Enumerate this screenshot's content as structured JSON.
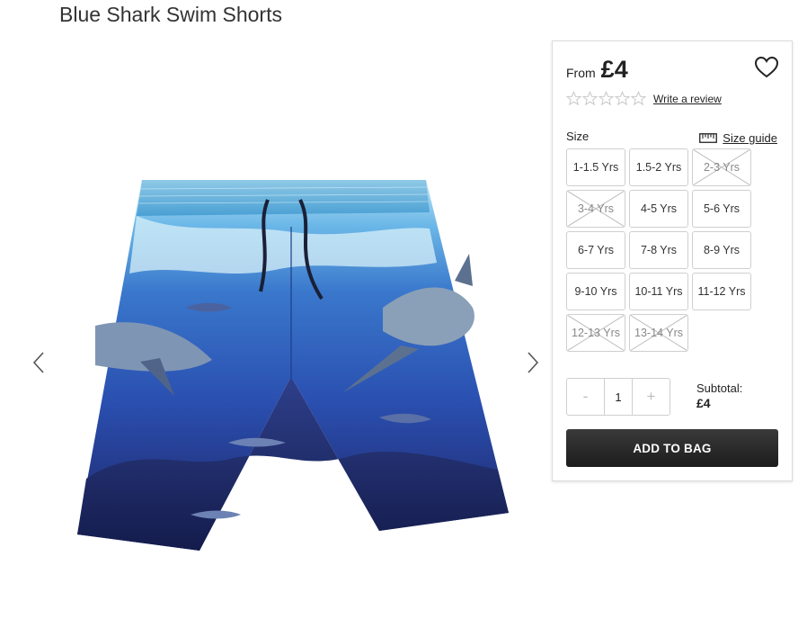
{
  "product": {
    "title": "Blue Shark Swim Shorts",
    "image_alt": "Blue Shark Swim Shorts"
  },
  "price": {
    "from_label": "From",
    "value": "£4"
  },
  "rating": {
    "stars_filled": 0,
    "stars_total": 5,
    "review_link": "Write a review"
  },
  "size": {
    "label": "Size",
    "guide_label": "Size guide",
    "options": [
      {
        "label": "1-1.5 Yrs",
        "available": true
      },
      {
        "label": "1.5-2 Yrs",
        "available": true
      },
      {
        "label": "2-3 Yrs",
        "available": false
      },
      {
        "label": "3-4 Yrs",
        "available": false
      },
      {
        "label": "4-5 Yrs",
        "available": true
      },
      {
        "label": "5-6 Yrs",
        "available": true
      },
      {
        "label": "6-7 Yrs",
        "available": true
      },
      {
        "label": "7-8 Yrs",
        "available": true
      },
      {
        "label": "8-9 Yrs",
        "available": true
      },
      {
        "label": "9-10 Yrs",
        "available": true
      },
      {
        "label": "10-11 Yrs",
        "available": true
      },
      {
        "label": "11-12 Yrs",
        "available": true
      },
      {
        "label": "12-13 Yrs",
        "available": false
      },
      {
        "label": "13-14 Yrs",
        "available": false
      }
    ]
  },
  "quantity": {
    "minus": "-",
    "value": "1",
    "plus": "+"
  },
  "subtotal": {
    "label": "Subtotal:",
    "value": "£4"
  },
  "cta": {
    "add_to_bag": "ADD TO BAG"
  },
  "icons": {
    "prev": "chevron-left-icon",
    "next": "chevron-right-icon",
    "wishlist": "heart-icon",
    "star": "star-outline-icon",
    "size_guide": "ruler-icon"
  },
  "colors": {
    "button_dark": "#2a2a2a",
    "border": "#cfcfcf",
    "star_outline": "#c8c8c8"
  }
}
